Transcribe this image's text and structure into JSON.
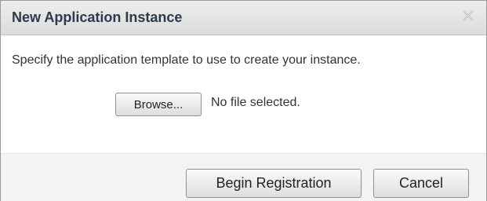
{
  "dialog": {
    "title": "New Application Instance",
    "close_icon": "close-icon",
    "instructions": "Specify the application template to use to create your instance.",
    "browse_label": "Browse...",
    "file_status": "No file selected.",
    "begin_label": "Begin Registration",
    "cancel_label": "Cancel"
  }
}
